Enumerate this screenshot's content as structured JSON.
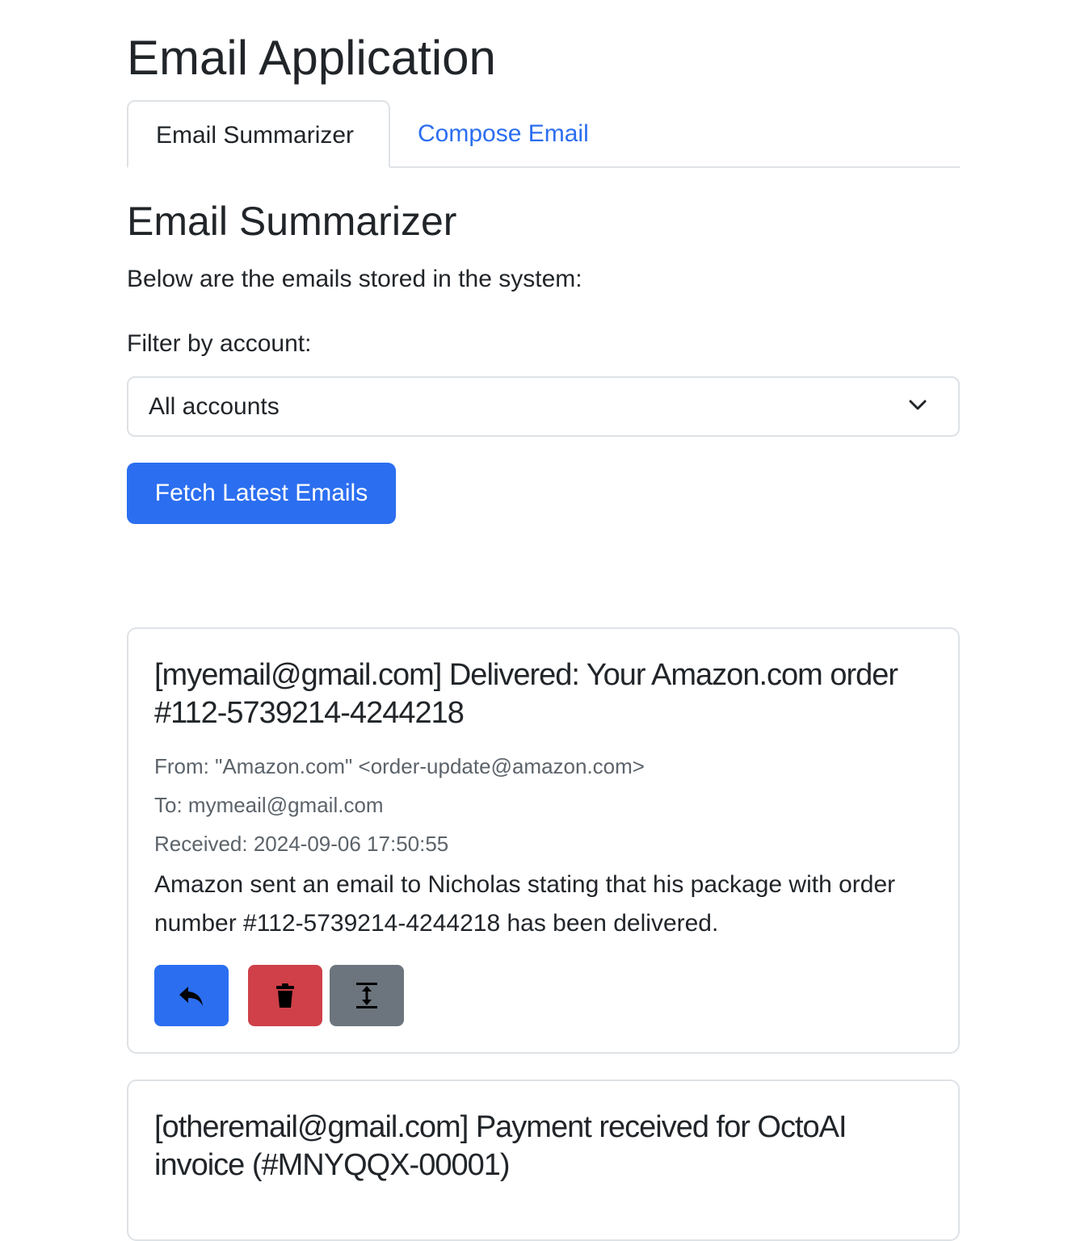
{
  "app": {
    "title": "Email Application"
  },
  "tabs": [
    {
      "label": "Email Summarizer",
      "active": true
    },
    {
      "label": "Compose Email",
      "active": false
    }
  ],
  "summarizer": {
    "title": "Email Summarizer",
    "intro": "Below are the emails stored in the system:",
    "filter_label": "Filter by account:",
    "filter_selected": "All accounts",
    "fetch_button": "Fetch Latest Emails"
  },
  "emails": [
    {
      "title": "[myemail@gmail.com] Delivered: Your Amazon.com order #112-5739214-4244218",
      "from": "From: \"Amazon.com\" <order-update@amazon.com>",
      "to": "To: mymeail@gmail.com",
      "received": "Received: 2024-09-06 17:50:55",
      "summary": "Amazon sent an email to Nicholas stating that his package with order number #112-5739214-4244218 has been delivered.",
      "actions": [
        "reply-icon",
        "trash-icon",
        "expand-vertical-icon"
      ]
    },
    {
      "title": "[otheremail@gmail.com] Payment received for OctoAI invoice (#MNYQQX-00001)"
    }
  ],
  "colors": {
    "primary": "#2b6ef0",
    "danger": "#cf4049",
    "secondary": "#6c757d",
    "muted_text": "#5c636a",
    "border": "#dee2e6"
  }
}
